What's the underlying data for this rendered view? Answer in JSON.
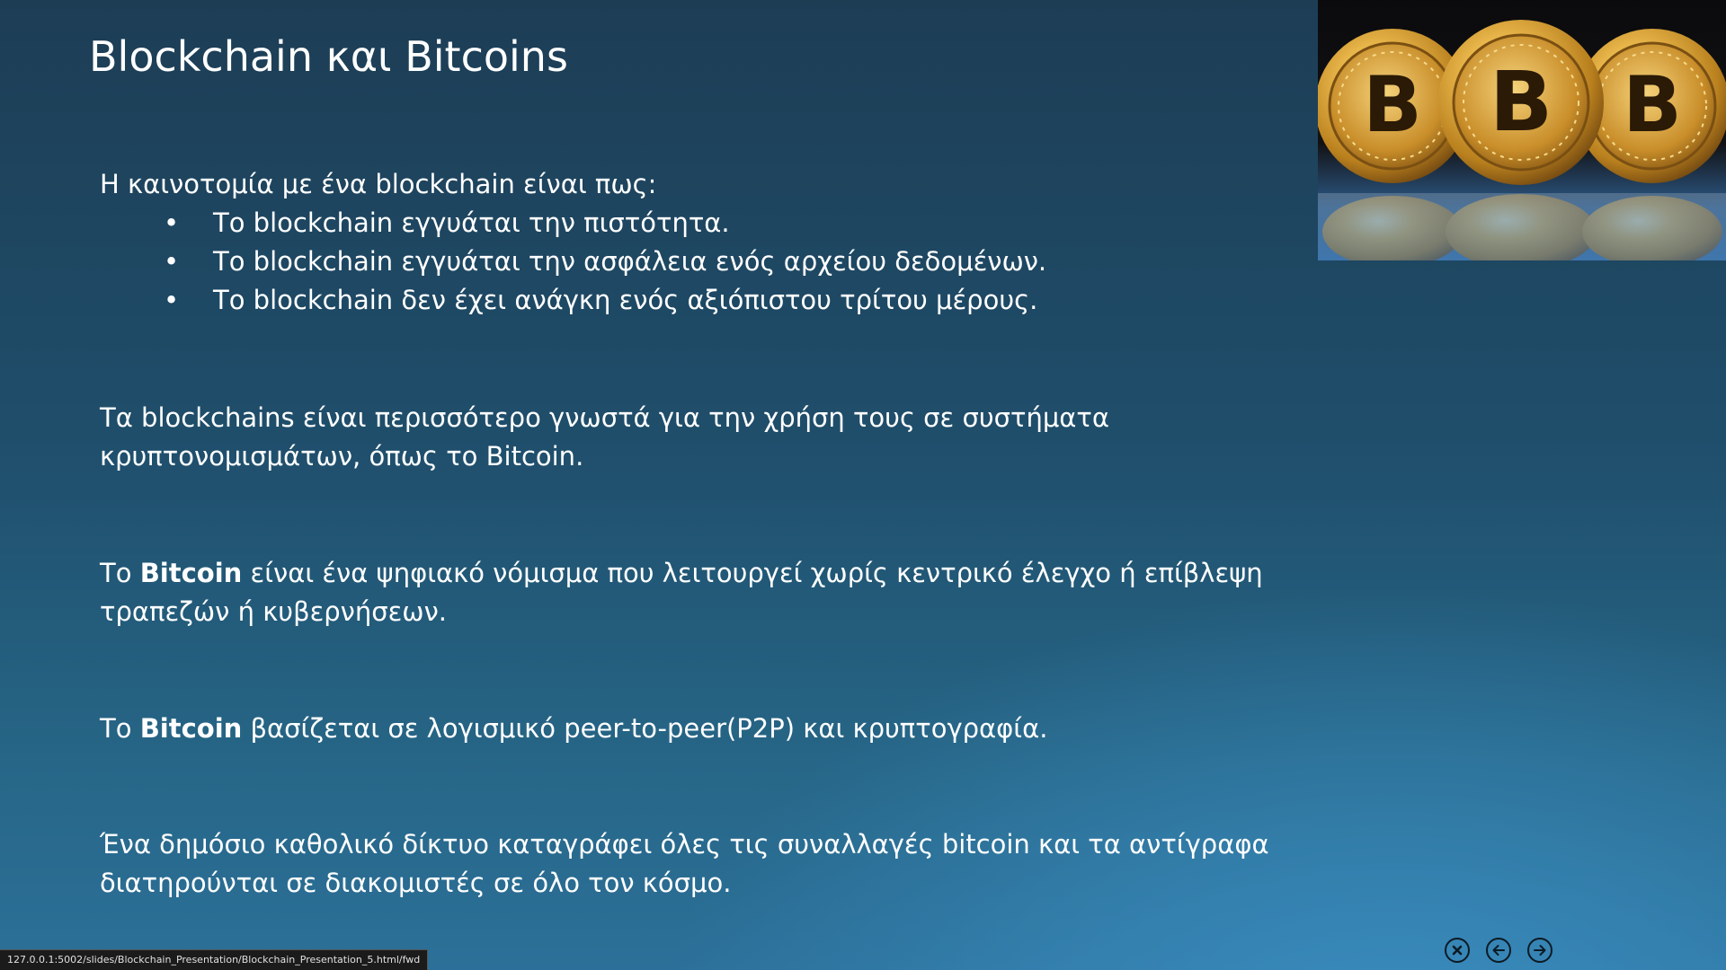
{
  "slide": {
    "title": "Blockchain και Bitcoins",
    "intro": "Η καινοτομία με ένα blockchain είναι πως:",
    "bullets": [
      "Το blockchain εγγυάται την πιστότητα.",
      "Το blockchain εγγυάται την ασφάλεια ενός αρχείου δεδομένων.",
      "Το blockchain δεν έχει ανάγκη ενός αξιόπιστου τρίτου μέρους."
    ],
    "bullet_symbol": "•",
    "paragraph2": "Τα blockchains είναι περισσότερο γνωστά για την χρήση τους σε συστήματα κρυπτονομισμάτων, όπως το Bitcoin.",
    "paragraph3": {
      "prefix": "Το ",
      "bold": "Bitcoin",
      "suffix": " είναι ένα ψηφιακό νόμισμα που λειτουργεί χωρίς κεντρικό έλεγχο ή επίβλεψη τραπεζών ή κυβερνήσεων."
    },
    "paragraph4": {
      "prefix": "Το ",
      "bold": "Bitcoin",
      "suffix": " βασίζεται σε λογισμικό peer-to-peer(P2P) και κρυπτογραφία."
    },
    "paragraph5": "Ένα δημόσιο καθολικό δίκτυο καταγράφει όλες τις συναλλαγές bitcoin και τα αντίγραφα διατηρούνται σε διακομιστές σε όλο τον κόσμο.",
    "image": {
      "alt": "bitcoin-coins-image",
      "coin_letter": "B",
      "coin_color": "#d9a336"
    }
  },
  "statusbar": {
    "url": "127.0.0.1:5002/slides/Blockchain_Presentation/Blockchain_Presentation_5.html/fwd"
  },
  "nav": {
    "close_icon": "close-circle-icon",
    "prev_icon": "arrow-left-circle-icon",
    "next_icon": "arrow-right-circle-icon"
  },
  "colors": {
    "background_top": "#1d3d55",
    "background_bottom": "#2c7099",
    "text": "#ffffff"
  }
}
